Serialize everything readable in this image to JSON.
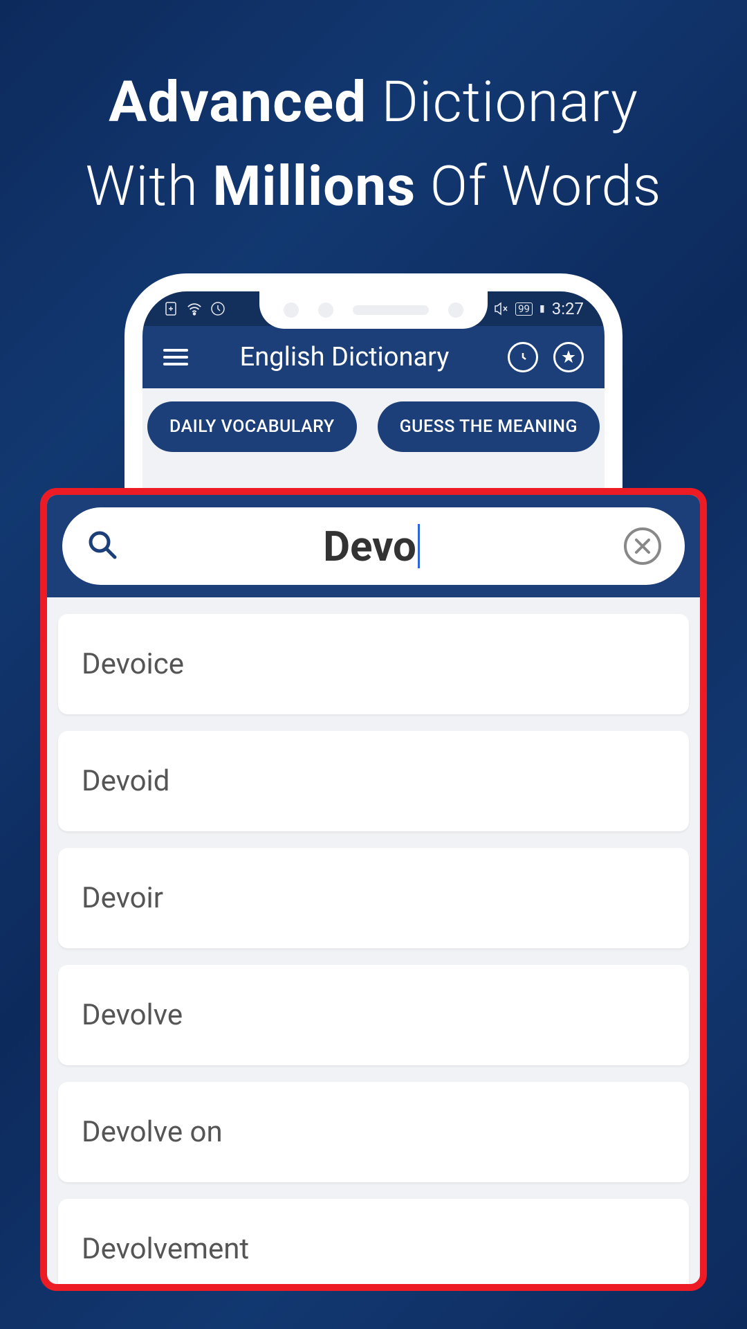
{
  "headline": {
    "line1_bold": "Advanced",
    "line1_rest": " Dictionary",
    "line2_pre": "With ",
    "line2_bold": "Millions",
    "line2_post": " Of Words"
  },
  "status": {
    "battery": "99",
    "time": "3:27"
  },
  "app_bar": {
    "title": "English Dictionary"
  },
  "chips": {
    "daily": "DAILY VOCABULARY",
    "guess": "GUESS THE MEANING"
  },
  "search": {
    "query": "Devo"
  },
  "results": [
    "Devoice",
    "Devoid",
    "Devoir",
    "Devolve",
    "Devolve on",
    "Devolvement"
  ]
}
